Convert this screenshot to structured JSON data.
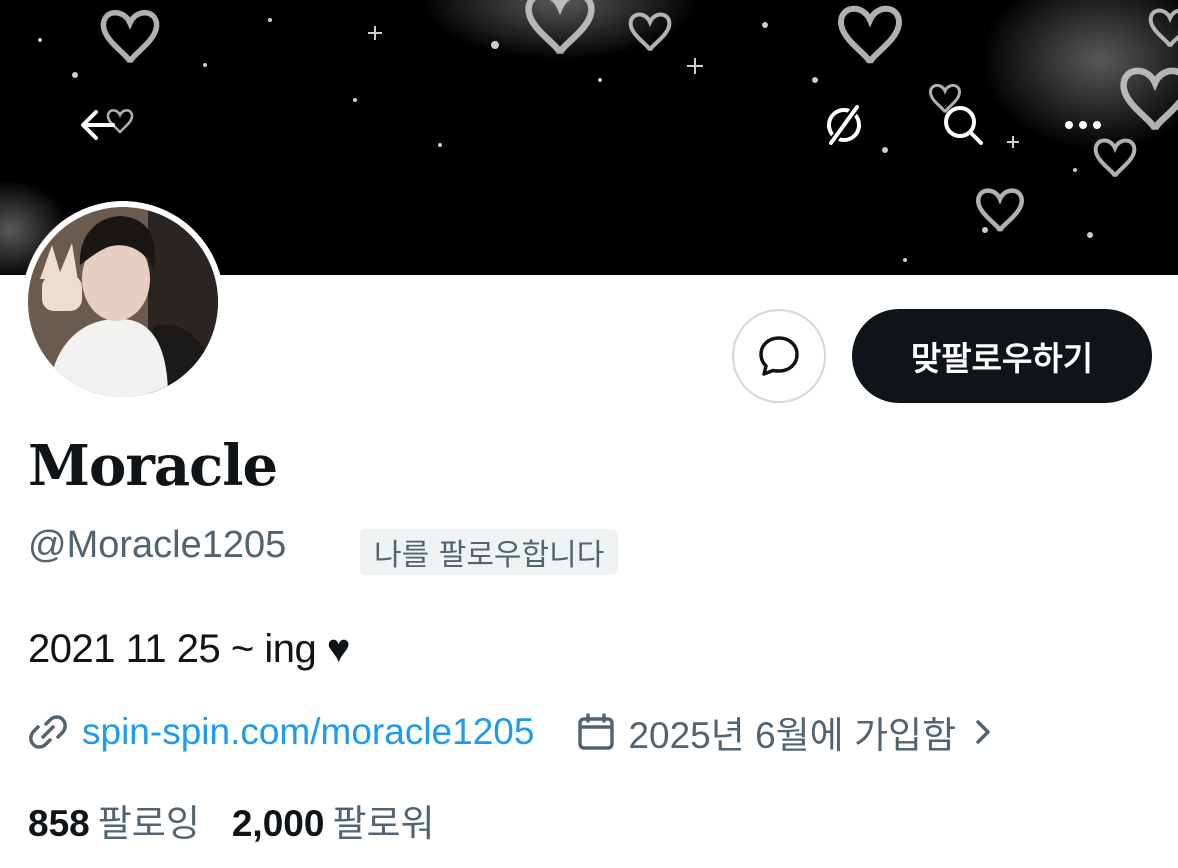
{
  "header": {
    "icons": {
      "back": "arrow-left-icon",
      "translate": "translate-icon",
      "search": "search-icon",
      "more": "more-dots-icon"
    }
  },
  "profile": {
    "display_name": "Moracle",
    "handle": "@Moracle1205",
    "follows_you_badge": "나를 팔로우합니다",
    "bio": "2021 11 25 ~ ing ♥",
    "link": "spin-spin.com/moracle1205",
    "joined": "2025년 6월에 가입함",
    "following_count": "858",
    "following_label": "팔로잉",
    "followers_count": "2,000",
    "followers_label": "팔로워"
  },
  "actions": {
    "follow_back_label": "맞팔로우하기",
    "message_icon": "message-bubble-icon"
  },
  "colors": {
    "text_primary": "#0f1419",
    "text_secondary": "#536471",
    "link": "#1d9bf0",
    "badge_bg": "#eff3f4",
    "button_dark": "#0f1419",
    "border": "#cfd9de"
  }
}
